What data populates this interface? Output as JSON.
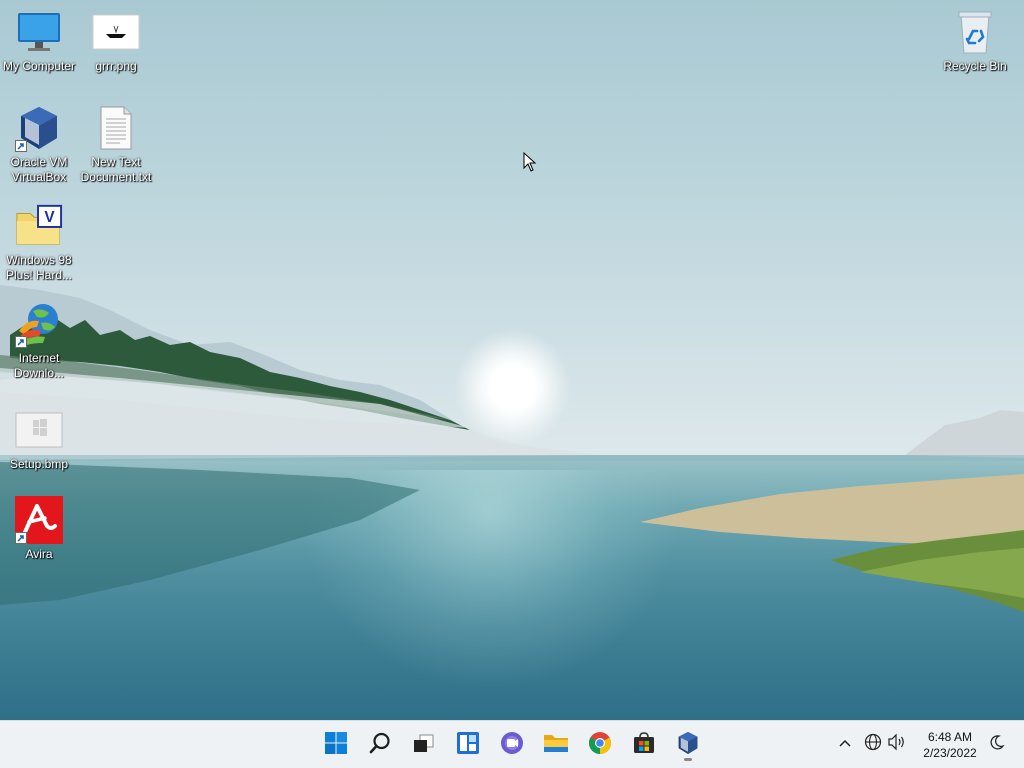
{
  "desktop": {
    "icons": [
      {
        "label": "My Computer"
      },
      {
        "label": "grrr.png"
      },
      {
        "label": "Oracle VM VirtualBox"
      },
      {
        "label": "New Text Document.txt"
      },
      {
        "label": "Windows 98 Plus! Hard..."
      },
      {
        "label": "Internet Downlo..."
      },
      {
        "label": "Setup.bmp"
      },
      {
        "label": "Avira"
      },
      {
        "label": "Recycle Bin"
      }
    ]
  },
  "taskbar": {
    "apps": [
      {
        "icon": "windows-start-icon"
      },
      {
        "icon": "search-icon"
      },
      {
        "icon": "task-view-icon"
      },
      {
        "icon": "widgets-icon"
      },
      {
        "icon": "teams-chat-icon"
      },
      {
        "icon": "file-explorer-icon"
      },
      {
        "icon": "chrome-icon"
      },
      {
        "icon": "microsoft-store-icon"
      },
      {
        "icon": "virtualbox-icon"
      }
    ],
    "tray": {
      "icons": [
        "chevron-up-icon",
        "network-icon",
        "volume-icon"
      ],
      "time": "6:48 AM",
      "date": "2/23/2022",
      "focus_icon": "moon-icon"
    }
  },
  "colors": {
    "accent": "#0067c0",
    "taskbar": "#eef2f5"
  }
}
